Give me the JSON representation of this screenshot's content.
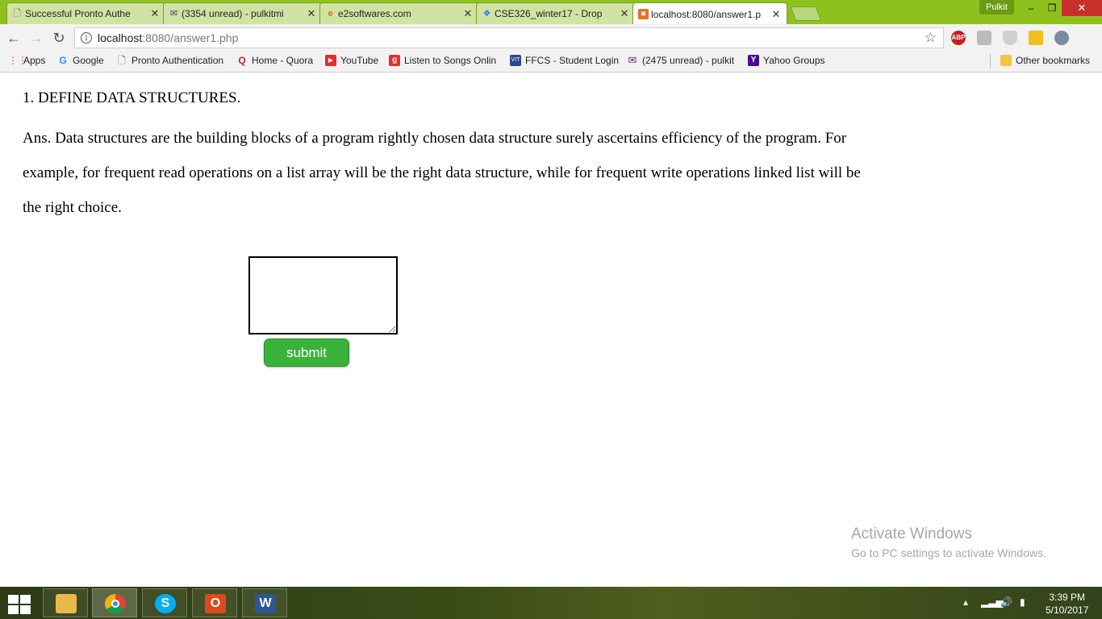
{
  "browser": {
    "tabs": [
      {
        "label": "Successful Pronto Authe",
        "icon": "document-icon",
        "active": false
      },
      {
        "label": "(3354 unread) - pulkitmi",
        "icon": "yahoo-mail-icon",
        "active": false
      },
      {
        "label": "e2softwares.com",
        "icon": "e2-icon",
        "active": false
      },
      {
        "label": "CSE326_winter17 - Drop",
        "icon": "dropbox-icon",
        "active": false
      },
      {
        "label": "localhost:8080/answer1.p",
        "icon": "xampp-icon",
        "active": true
      }
    ],
    "profile_name": "Pulkit",
    "window_controls": {
      "minimize": "–",
      "restore": "❐",
      "close": "✕"
    },
    "address": {
      "host": "localhost",
      "path": ":8080/answer1.php"
    },
    "bookmarks": [
      {
        "label": "Apps",
        "icon": "apps-grid-icon"
      },
      {
        "label": "Google",
        "icon": "google-icon"
      },
      {
        "label": "Pronto Authentication",
        "icon": "document-icon"
      },
      {
        "label": "Home - Quora",
        "icon": "quora-icon"
      },
      {
        "label": "YouTube",
        "icon": "youtube-icon"
      },
      {
        "label": "Listen to Songs Onlin",
        "icon": "gaana-icon"
      },
      {
        "label": "FFCS - Student Login",
        "icon": "vit-icon"
      },
      {
        "label": "(2475 unread) - pulkit",
        "icon": "yahoo-mail-icon"
      },
      {
        "label": "Yahoo Groups",
        "icon": "yahoo-icon"
      }
    ],
    "other_bookmarks": "Other bookmarks",
    "extensions": {
      "abp": "ABP"
    }
  },
  "page": {
    "question": "1. DEFINE DATA STRUCTURES.",
    "answer": "Ans. Data structures are the building blocks of a program rightly chosen data structure surely ascertains efficiency of the program. For example, for frequent read operations on a list array will be the right data structure, while for frequent write operations linked list will be the right choice.",
    "answer_input_value": "",
    "submit_label": "submit"
  },
  "watermark": {
    "line1": "Activate Windows",
    "line2": "Go to PC settings to activate Windows."
  },
  "taskbar": {
    "apps": [
      {
        "name": "file-explorer",
        "glyph": "📁",
        "color": "#e8b94a"
      },
      {
        "name": "chrome",
        "glyph": "",
        "color": "#ffffff"
      },
      {
        "name": "skype",
        "glyph": "S",
        "color": "#00aff0"
      },
      {
        "name": "office",
        "glyph": "O",
        "color": "#e0491e"
      },
      {
        "name": "word",
        "glyph": "W",
        "color": "#2b5797"
      }
    ],
    "time": "3:39 PM",
    "date": "5/10/2017"
  }
}
